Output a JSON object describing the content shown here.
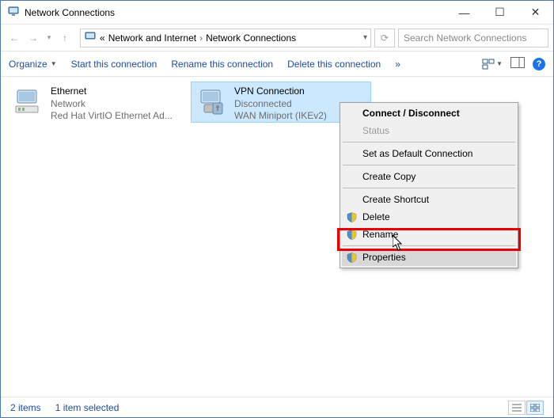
{
  "window": {
    "title": "Network Connections"
  },
  "breadcrumb": {
    "root": "«",
    "level1": "Network and Internet",
    "level2": "Network Connections"
  },
  "search": {
    "placeholder": "Search Network Connections"
  },
  "commands": {
    "organize": "Organize",
    "start": "Start this connection",
    "rename": "Rename this connection",
    "delete": "Delete this connection",
    "overflow": "»"
  },
  "connections": [
    {
      "name": "Ethernet",
      "status": "Network",
      "device": "Red Hat VirtIO Ethernet Ad..."
    },
    {
      "name": "VPN Connection",
      "status": "Disconnected",
      "device": "WAN Miniport (IKEv2)"
    }
  ],
  "context_menu": {
    "connect": "Connect / Disconnect",
    "status": "Status",
    "default": "Set as Default Connection",
    "copy": "Create Copy",
    "shortcut": "Create Shortcut",
    "delete": "Delete",
    "rename": "Rename",
    "properties": "Properties"
  },
  "statusbar": {
    "count": "2 items",
    "selected": "1 item selected"
  }
}
